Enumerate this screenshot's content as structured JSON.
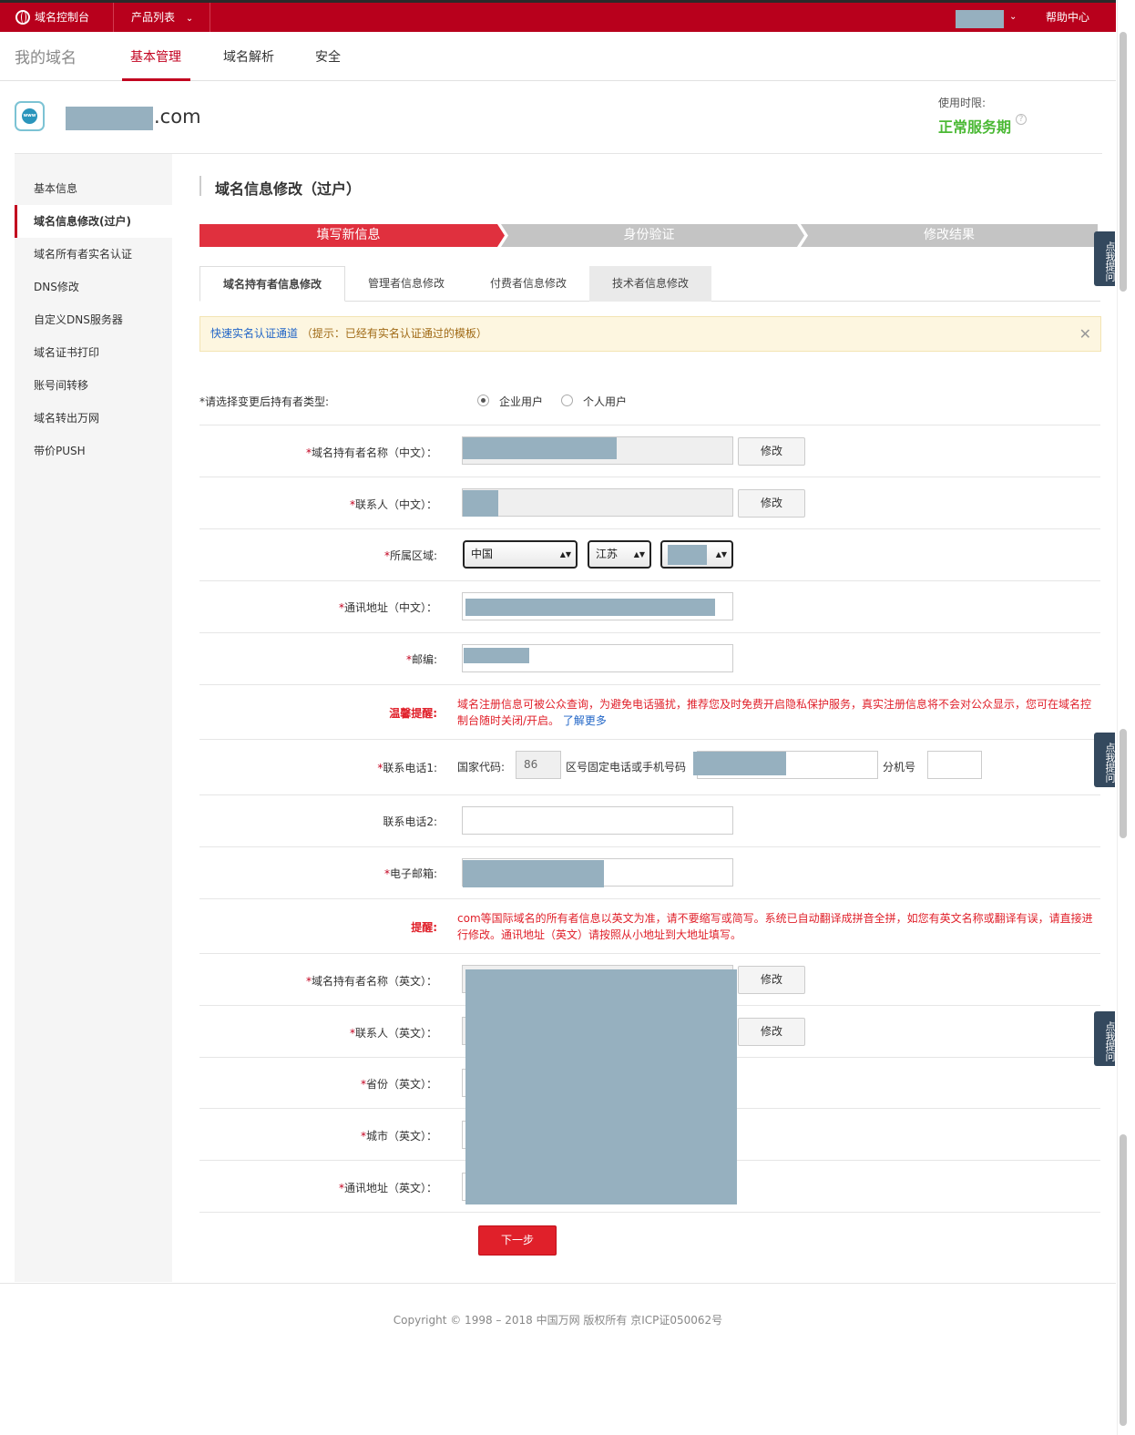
{
  "topbar": {
    "console": "域名控制台",
    "products": "产品列表",
    "chevron": "⌄",
    "help": "帮助中心"
  },
  "nav": {
    "brand": "我的域名",
    "tabs": [
      "基本管理",
      "域名解析",
      "安全"
    ]
  },
  "domain": {
    "suffix": ".com",
    "icon_text": "www",
    "term_label": "使用时限:",
    "term_value": "正常服务期"
  },
  "sidebar": {
    "items": [
      "基本信息",
      "域名信息修改(过户)",
      "域名所有者实名认证",
      "DNS修改",
      "自定义DNS服务器",
      "域名证书打印",
      "账号间转移",
      "域名转出万网",
      "带价PUSH"
    ]
  },
  "page_title": "域名信息修改（过户）",
  "steps": [
    "填写新信息",
    "身份验证",
    "修改结果"
  ],
  "tabs": [
    "域名持有者信息修改",
    "管理者信息修改",
    "付费者信息修改",
    "技术者信息修改"
  ],
  "notice": {
    "link": "快速实名认证通道",
    "tip": "（提示：已经有实名认证通过的模板）",
    "close": "✕"
  },
  "form": {
    "holder_type_label": "*请选择变更后持有者类型:",
    "radio_enterprise": "企业用户",
    "radio_personal": "个人用户",
    "owner_cn_label": "域名持有者名称（中文）：",
    "contact_cn_label": "联系人（中文）：",
    "region_label": "所属区域:",
    "region_country": "中国",
    "region_province": "江苏",
    "address_cn_label": "通讯地址（中文）：",
    "postcode_label": "邮编:",
    "edit_button": "修改",
    "warm_tip_label": "温馨提醒:",
    "warm_tip_text": "域名注册信息可被公众查询，为避免电话骚扰，推荐您及时免费开启隐私保护服务，真实注册信息将不会对公众显示，您可在域名控制台随时关闭/开启。",
    "learn_more": "了解更多",
    "phone1_label": "联系电话1:",
    "country_code_label": "国家代码:",
    "country_code_value": "86",
    "area_phone_label": "区号固定电话或手机号码",
    "extension_label": "分机号",
    "phone2_label": "联系电话2:",
    "email_label": "电子邮箱:",
    "reminder_label": "提醒:",
    "reminder_text": "com等国际域名的所有者信息以英文为准，请不要缩写或简写。系统已自动翻译成拼音全拼，如您有英文名称或翻译有误，请直接进行修改。通讯地址（英文）请按照从小地址到大地址填写。",
    "owner_en_label": "域名持有者名称（英文）：",
    "contact_en_label": "联系人（英文）：",
    "province_en_label": "省份（英文）：",
    "city_en_label": "城市（英文）：",
    "address_en_label": "通讯地址（英文）：",
    "next_button": "下一步"
  },
  "footer": "Copyright © 1998 – 2018 中国万网 版权所有 京ICP证050062号",
  "float_button": "点我提问",
  "colors": {
    "brand_red": "#b8001c",
    "active_red": "#c2001f",
    "step_active": "#e0303e",
    "step_inactive": "#c4c4c4",
    "success_green": "#4bb935",
    "redacted": "#96b0bf"
  }
}
